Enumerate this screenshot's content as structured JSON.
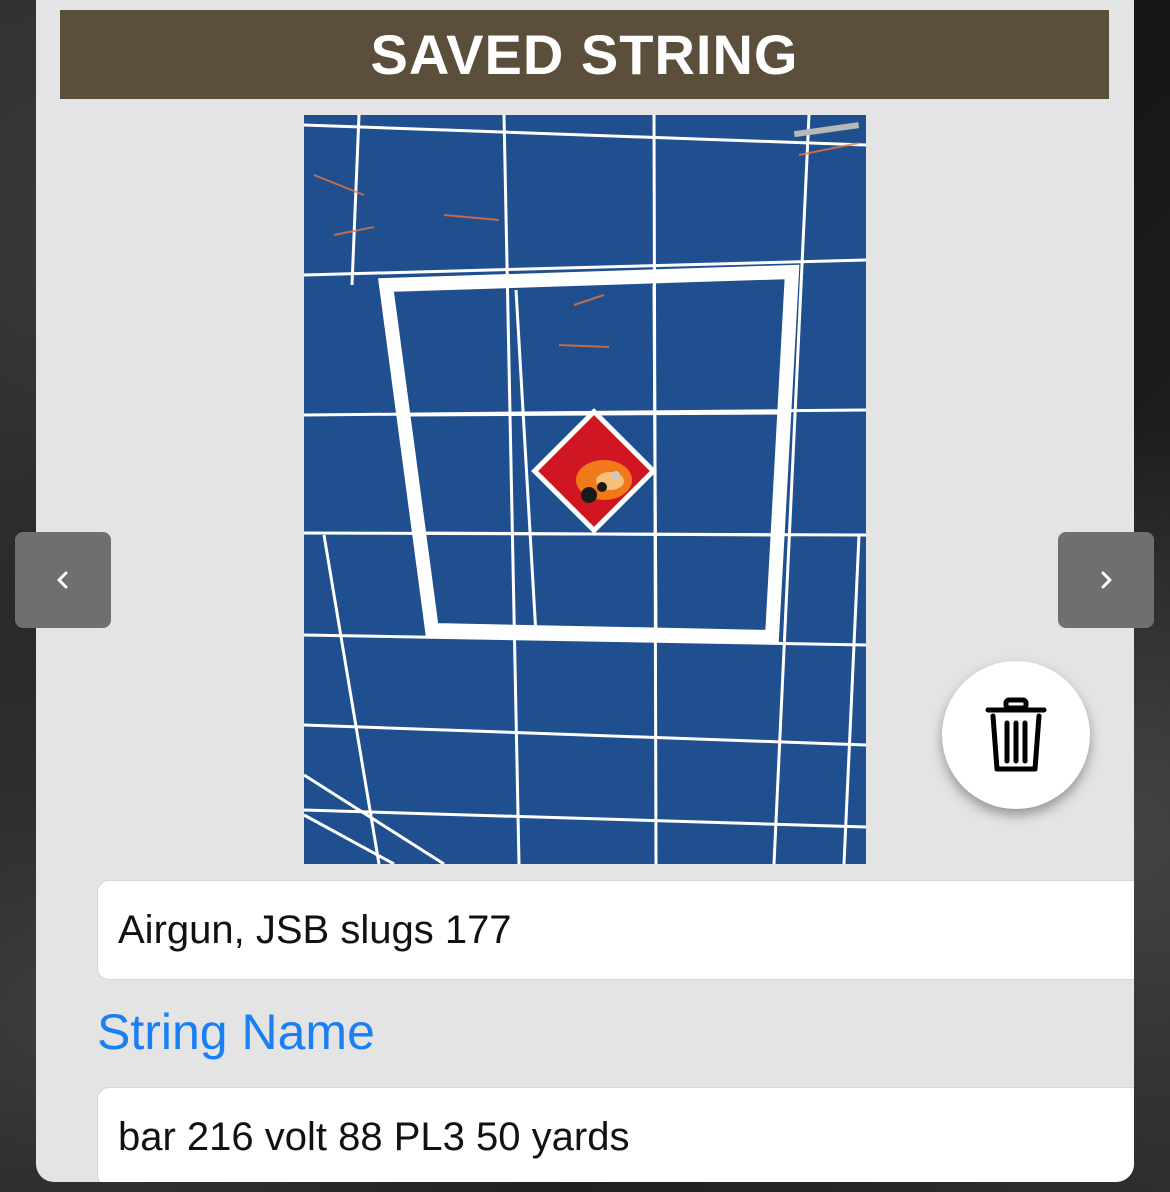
{
  "header": {
    "title": "SAVED STRING"
  },
  "photo": {
    "alt": "Shot target photo",
    "icon": "target-photo"
  },
  "nav": {
    "prev_icon": "chevron-left-icon",
    "next_icon": "chevron-right-icon"
  },
  "actions": {
    "delete_icon": "trash-icon"
  },
  "fields": {
    "ammo_value": "Airgun, JSB slugs 177",
    "string_name_label": "String Name",
    "string_name_value": "bar 216 volt 88 PL3 50 yards"
  },
  "colors": {
    "title_bar": "#5b4f3b",
    "label_accent": "#1a7ef5",
    "modal_bg": "#e4e4e4",
    "target_blue": "#1f4f8f",
    "target_red": "#d01622"
  }
}
